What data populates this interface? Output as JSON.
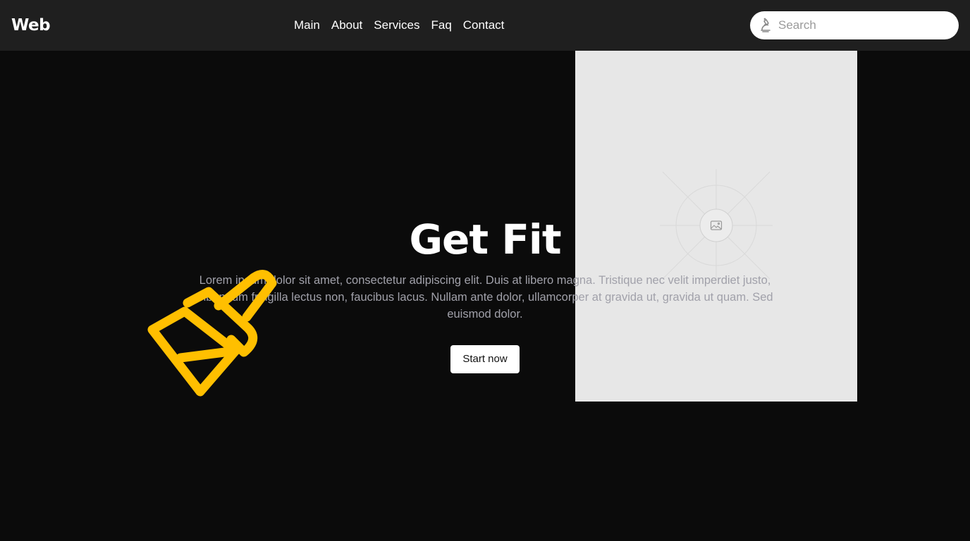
{
  "header": {
    "logo": "Web",
    "nav": [
      "Main",
      "About",
      "Services",
      "Faq",
      "Contact"
    ],
    "search": {
      "placeholder": "Search",
      "value": "",
      "icon": "microscope-icon"
    }
  },
  "hero": {
    "title": "Get Fit",
    "text": "Lorem ipsum dolor sit amet, consectetur adipiscing elit. Duis at libero magna. Tristique nec velit imperdiet justo, bibendum fringilla lectus non, faucibus lacus. Nullam ante dolor, ullamcorper at gravida ut, gravida ut quam. Sed euismod dolor.",
    "cta": "Start now",
    "decor_icon": "paint-brush-icon",
    "image_icon": "image-placeholder-icon"
  },
  "colors": {
    "header_bg": "#1f1f1f",
    "page_bg": "#0b0b0b",
    "accent": "#ffbf00",
    "placeholder_bg": "#e7e7e7",
    "body_text": "#a1a1aa"
  }
}
